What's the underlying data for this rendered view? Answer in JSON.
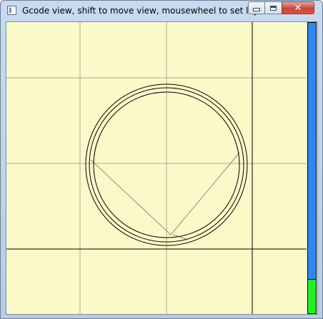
{
  "window": {
    "title": "Gcode view, shift to move view, mousewheel to set layer",
    "close_symbol": "✕"
  },
  "icons": {
    "app": "app-window-icon",
    "minimize": "minimize-icon",
    "maximize": "maximize-icon",
    "close": "close-icon"
  },
  "view": {
    "background_color": "#fafac8",
    "grid_color": "#a9aa95",
    "bed_edge_color": "#000000",
    "toolpath_color": "#000000",
    "travel_color": "#8d8d82"
  },
  "layer_indicator": {
    "current_layer_fraction": 0.12,
    "track_color": "#2e86f0",
    "fill_color": "#22ee22"
  }
}
